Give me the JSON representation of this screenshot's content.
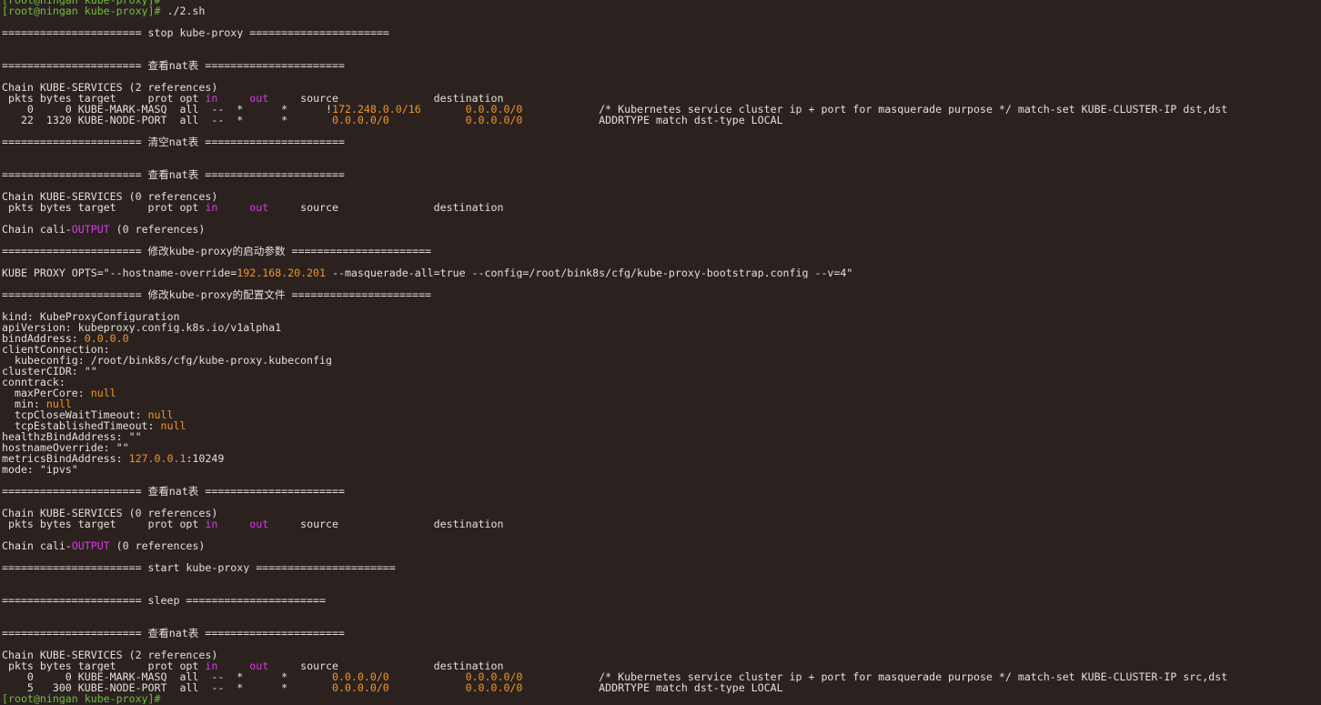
{
  "colors": {
    "background": "#2b2220",
    "text": "#e3e0d7",
    "prompt": "#6fbf3f",
    "number": "#f0952b",
    "keyword": "#d43ee0"
  },
  "lines": [
    [
      {
        "t": "[root@ningan kube-proxy]#",
        "c": "green"
      }
    ],
    [
      {
        "t": "[root@ningan kube-proxy]#",
        "c": "green"
      },
      {
        "t": " ./2.sh"
      }
    ],
    [],
    [
      {
        "t": "====================== stop kube-proxy ======================"
      }
    ],
    [],
    [],
    [
      {
        "t": "====================== 查看nat表 ======================"
      }
    ],
    [],
    [
      {
        "t": "Chain KUBE-SERVICES (2 references)"
      }
    ],
    [
      {
        "t": " pkts bytes target     prot opt "
      },
      {
        "t": "in",
        "c": "magenta"
      },
      {
        "t": "     "
      },
      {
        "t": "out",
        "c": "magenta"
      },
      {
        "t": "     source               destination"
      }
    ],
    [
      {
        "t": "    0     0 KUBE-MARK-MASQ  all  --  *      *      !"
      },
      {
        "t": "172.248.0.0/16",
        "c": "orange"
      },
      {
        "t": "       "
      },
      {
        "t": "0.0.0.0/0",
        "c": "orange"
      },
      {
        "t": "            /* Kubernetes service cluster ip + port for masquerade purpose */ match-set KUBE-CLUSTER-IP dst,dst"
      }
    ],
    [
      {
        "t": "   22  1320 KUBE-NODE-PORT  all  --  *      *       "
      },
      {
        "t": "0.0.0.0/0",
        "c": "orange"
      },
      {
        "t": "            "
      },
      {
        "t": "0.0.0.0/0",
        "c": "orange"
      },
      {
        "t": "            ADDRTYPE match dst-type LOCAL"
      }
    ],
    [],
    [
      {
        "t": "====================== 清空nat表 ======================"
      }
    ],
    [],
    [],
    [
      {
        "t": "====================== 查看nat表 ======================"
      }
    ],
    [],
    [
      {
        "t": "Chain KUBE-SERVICES (0 references)"
      }
    ],
    [
      {
        "t": " pkts bytes target     prot opt "
      },
      {
        "t": "in",
        "c": "magenta"
      },
      {
        "t": "     "
      },
      {
        "t": "out",
        "c": "magenta"
      },
      {
        "t": "     source               destination"
      }
    ],
    [],
    [
      {
        "t": "Chain cali-"
      },
      {
        "t": "OUTPUT",
        "c": "magenta"
      },
      {
        "t": " (0 references)"
      }
    ],
    [],
    [
      {
        "t": "====================== 修改kube-proxy的启动参数 ======================"
      }
    ],
    [],
    [
      {
        "t": "KUBE_PROXY_OPTS=\"--hostname-override="
      },
      {
        "t": "192.168.20.201",
        "c": "orange"
      },
      {
        "t": " --masquerade-all=true --config=/root/bink8s/cfg/kube-proxy-bootstrap.config --v=4\""
      }
    ],
    [],
    [
      {
        "t": "====================== 修改kube-proxy的配置文件 ======================"
      }
    ],
    [],
    [
      {
        "t": "kind: KubeProxyConfiguration"
      }
    ],
    [
      {
        "t": "apiVersion: kubeproxy.config.k8s.io/v1alpha1"
      }
    ],
    [
      {
        "t": "bindAddress: "
      },
      {
        "t": "0.0.0.0",
        "c": "orange"
      }
    ],
    [
      {
        "t": "clientConnection:"
      }
    ],
    [
      {
        "t": "  kubeconfig: /root/bink8s/cfg/kube-proxy.kubeconfig"
      }
    ],
    [
      {
        "t": "clusterCIDR: \"\""
      }
    ],
    [
      {
        "t": "conntrack:"
      }
    ],
    [
      {
        "t": "  maxPerCore: "
      },
      {
        "t": "null",
        "c": "orange"
      }
    ],
    [
      {
        "t": "  min: "
      },
      {
        "t": "null",
        "c": "orange"
      }
    ],
    [
      {
        "t": "  tcpCloseWaitTimeout: "
      },
      {
        "t": "null",
        "c": "orange"
      }
    ],
    [
      {
        "t": "  tcpEstablishedTimeout: "
      },
      {
        "t": "null",
        "c": "orange"
      }
    ],
    [
      {
        "t": "healthzBindAddress: \"\""
      }
    ],
    [
      {
        "t": "hostnameOverride: \"\""
      }
    ],
    [
      {
        "t": "metricsBindAddress: "
      },
      {
        "t": "127.0.0.1",
        "c": "orange"
      },
      {
        "t": ":10249"
      }
    ],
    [
      {
        "t": "mode: \"ipvs\""
      }
    ],
    [],
    [
      {
        "t": "====================== 查看nat表 ======================"
      }
    ],
    [],
    [
      {
        "t": "Chain KUBE-SERVICES (0 references)"
      }
    ],
    [
      {
        "t": " pkts bytes target     prot opt "
      },
      {
        "t": "in",
        "c": "magenta"
      },
      {
        "t": "     "
      },
      {
        "t": "out",
        "c": "magenta"
      },
      {
        "t": "     source               destination"
      }
    ],
    [],
    [
      {
        "t": "Chain cali-"
      },
      {
        "t": "OUTPUT",
        "c": "magenta"
      },
      {
        "t": " (0 references)"
      }
    ],
    [],
    [
      {
        "t": "====================== start kube-proxy ======================"
      }
    ],
    [],
    [],
    [
      {
        "t": "====================== sleep ======================"
      }
    ],
    [],
    [],
    [
      {
        "t": "====================== 查看nat表 ======================"
      }
    ],
    [],
    [
      {
        "t": "Chain KUBE-SERVICES (2 references)"
      }
    ],
    [
      {
        "t": " pkts bytes target     prot opt "
      },
      {
        "t": "in",
        "c": "magenta"
      },
      {
        "t": "     "
      },
      {
        "t": "out",
        "c": "magenta"
      },
      {
        "t": "     source               destination"
      }
    ],
    [
      {
        "t": "    0     0 KUBE-MARK-MASQ  all  --  *      *       "
      },
      {
        "t": "0.0.0.0/0",
        "c": "orange"
      },
      {
        "t": "            "
      },
      {
        "t": "0.0.0.0/0",
        "c": "orange"
      },
      {
        "t": "            /* Kubernetes service cluster ip + port for masquerade purpose */ match-set KUBE-CLUSTER-IP src,dst"
      }
    ],
    [
      {
        "t": "    5   300 KUBE-NODE-PORT  all  --  *      *       "
      },
      {
        "t": "0.0.0.0/0",
        "c": "orange"
      },
      {
        "t": "            "
      },
      {
        "t": "0.0.0.0/0",
        "c": "orange"
      },
      {
        "t": "            ADDRTYPE match dst-type LOCAL"
      }
    ],
    [
      {
        "t": "[root@ningan kube-proxy]#",
        "c": "green"
      }
    ]
  ]
}
